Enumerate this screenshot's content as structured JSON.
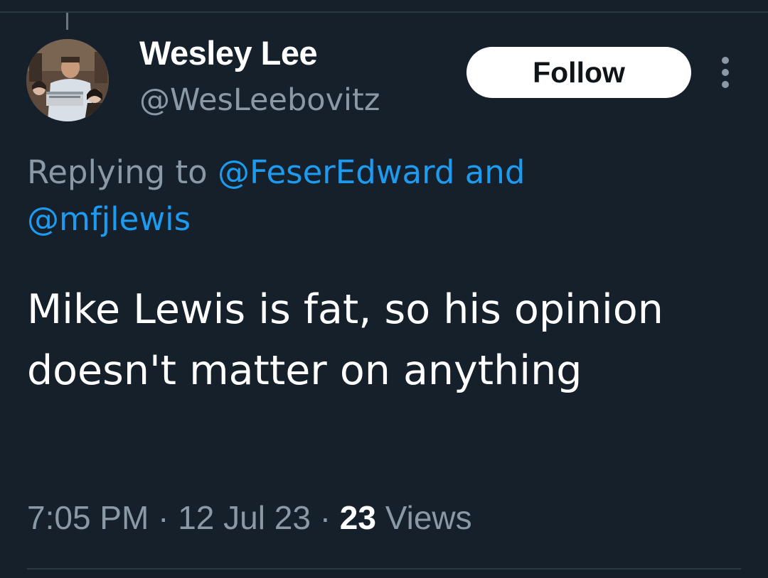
{
  "tweet": {
    "author": {
      "display_name": "Wesley Lee",
      "handle": "@WesLeebovitz",
      "avatar_icon": "profile-photo"
    },
    "follow_label": "Follow",
    "more_icon": "more-vertical-icon",
    "reply_context": {
      "prefix": "Replying to",
      "mention_1": "@FeserEdward",
      "conjunction": "and",
      "mention_2": "@mfjlewis"
    },
    "text": "Mike Lewis is fat, so his opinion doesn't matter on anything",
    "meta": {
      "time": "7:05 PM",
      "separator": "·",
      "date": "12 Jul 23",
      "views_count": "23",
      "views_label": "Views"
    }
  },
  "colors": {
    "background": "#15202b",
    "primary_text": "#ffffff",
    "secondary_text": "#8b98a5",
    "link": "#1d9bf0",
    "follow_bg": "#ffffff",
    "follow_text": "#0f1419"
  }
}
